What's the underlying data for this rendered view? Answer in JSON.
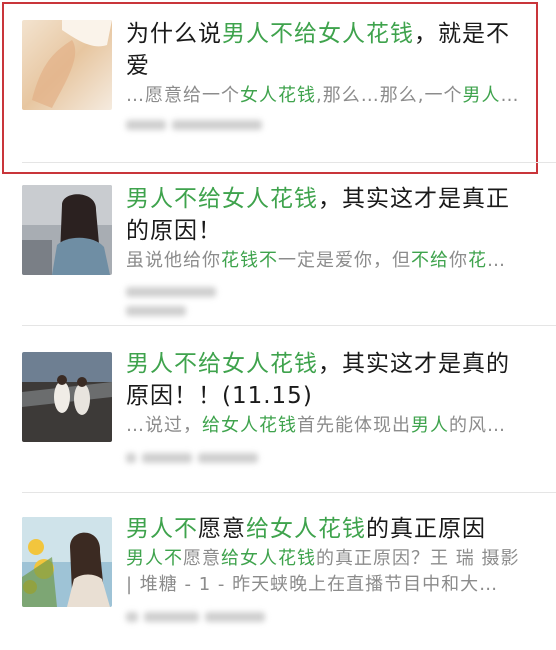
{
  "results": [
    {
      "title": [
        {
          "t": "为什么说",
          "h": false
        },
        {
          "t": "男人不给女人花钱",
          "h": true
        },
        {
          "t": "，就是不爱",
          "h": false
        }
      ],
      "snippet": [
        {
          "t": "…愿意给一个",
          "h": false
        },
        {
          "t": "女人花钱",
          "h": true
        },
        {
          "t": ",那么…那么,一个",
          "h": false
        },
        {
          "t": "男人",
          "h": true
        },
        {
          "t": "…",
          "h": false
        }
      ],
      "highlighted": true
    },
    {
      "title": [
        {
          "t": "男人不给女人花钱",
          "h": true
        },
        {
          "t": "，其实这才是真正的原因！",
          "h": false
        }
      ],
      "snippet": [
        {
          "t": "虽说他给你",
          "h": false
        },
        {
          "t": "花钱",
          "h": true
        },
        {
          "t": "不",
          "h": true
        },
        {
          "t": "一定是爱你，但",
          "h": false
        },
        {
          "t": "不给",
          "h": true
        },
        {
          "t": "你",
          "h": false
        },
        {
          "t": "花",
          "h": true
        },
        {
          "t": "…",
          "h": false
        }
      ],
      "highlighted": false
    },
    {
      "title": [
        {
          "t": "男人不给女人花钱",
          "h": true
        },
        {
          "t": "，其实这才是真的原因！！(11.15)",
          "h": false
        }
      ],
      "snippet": [
        {
          "t": "…说过，",
          "h": false
        },
        {
          "t": "给女人花钱",
          "h": true
        },
        {
          "t": "首先能体现出",
          "h": false
        },
        {
          "t": "男人",
          "h": true
        },
        {
          "t": "的风…",
          "h": false
        }
      ],
      "highlighted": false
    },
    {
      "title": [
        {
          "t": "男人不",
          "h": true
        },
        {
          "t": "愿意",
          "h": false
        },
        {
          "t": "给女人花钱",
          "h": true
        },
        {
          "t": "的真正原因",
          "h": false
        }
      ],
      "snippet": [
        {
          "t": "男人不",
          "h": true
        },
        {
          "t": "愿意",
          "h": false
        },
        {
          "t": "给女人花钱",
          "h": true
        },
        {
          "t": "的真正原因？王 瑞 摄影 | 堆糖 - 1 - 昨天蛱晚上在直播节目中和大…",
          "h": false
        }
      ],
      "highlighted": false
    }
  ],
  "colors": {
    "highlight_text": "#3fa34d",
    "frame": "#c9353a"
  }
}
